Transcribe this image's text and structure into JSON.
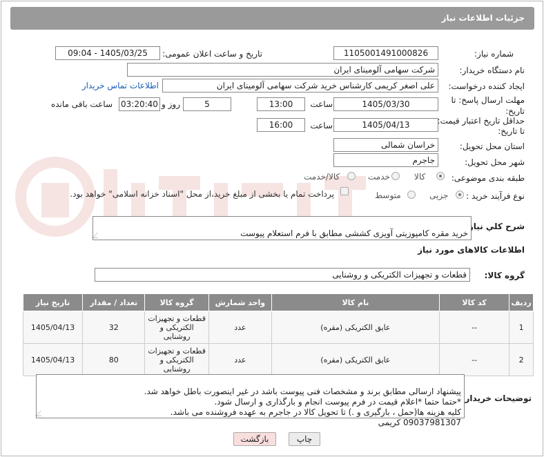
{
  "header": {
    "title": "جزئیات اطلاعات نیاز"
  },
  "form": {
    "need_number_label": "شماره نیاز:",
    "need_number": "1105001491000826",
    "announce_label": "تاریخ و ساعت اعلان عمومی:",
    "announce_value": "1405/03/25 - 09:04",
    "buyer_org_label": "نام دستگاه خریدار:",
    "buyer_org": "شرکت سهامی آلومینای ایران",
    "creator_label": "ایجاد کننده درخواست:",
    "creator": "علی اصغر کریمی کارشناس خرید شرکت سهامی آلومینای ایران",
    "contact_link": "اطلاعات تماس خریدار",
    "deadline_label_1": "مهلت ارسال پاسخ: تا",
    "deadline_label_2": "تاریخ:",
    "deadline_date": "1405/03/30",
    "time_label": "ساعت",
    "deadline_time": "13:00",
    "days_value": "5",
    "days_label": "روز و",
    "remaining_value": "03:20:40",
    "remaining_label": "ساعت باقی مانده",
    "validity_label_1": "حداقل تاریخ اعتبار قیمت:",
    "validity_label_2": "تا تاریخ:",
    "validity_date": "1405/04/13",
    "validity_time": "16:00",
    "province_label": "استان محل تحویل:",
    "province": "خراسان شمالی",
    "city_label": "شهر محل تحویل:",
    "city": "جاجرم",
    "category_label": "طبقه بندی موضوعی:",
    "category_options": [
      "کالا",
      "خدمت",
      "کالا/خدمت"
    ],
    "purchase_type_label": "نوع فرآیند خرید :",
    "purchase_options": [
      "جزیی",
      "متوسط"
    ],
    "payment_note": "پرداخت تمام یا بخشی از مبلغ خرید،از محل \"اسناد خزانه اسلامی\" خواهد بود."
  },
  "description": {
    "label": "شرح کلي نياز:",
    "text": "خرید مقره کامپوزیتی آویزی کششی مطابق با فرم استعلام پیوست"
  },
  "goods": {
    "section_title": "اطلاعات کالاهای مورد نیاز",
    "group_label": "گروه کالا:",
    "group_value": "قطعات و تجهیزات الکتریکی و روشنایی",
    "columns": [
      "ردیف",
      "کد کالا",
      "نام کالا",
      "واحد شمارش",
      "گروه کالا",
      "تعداد / مقدار",
      "تاریخ نیاز"
    ],
    "rows": [
      {
        "row": "1",
        "code": "--",
        "name": "عایق الکتریکی (مقره)",
        "unit": "عدد",
        "group": "قطعات و تجهیزات الکتریکی و روشنایی",
        "qty": "32",
        "date": "1405/04/13"
      },
      {
        "row": "2",
        "code": "--",
        "name": "عایق الکتریکی (مقره)",
        "unit": "عدد",
        "group": "قطعات و تجهیزات الکتریکی و روشنایی",
        "qty": "80",
        "date": "1405/04/13"
      }
    ]
  },
  "buyer_notes": {
    "label": "توضیحات خریدار:",
    "text": "پیشنهاد ارسالی مطابق برند و مشخصات فنی پیوست باشد در غیر اینصورت باطل خواهد شد.\n*حتما حتما *اعلام قیمت در فرم پیوست انجام و بارگذاری و ارسال شود.\nکلیه هزینه ها(حمل ، بارگیری و .) تا تحویل کالا در جاجرم به عهده فروشنده می باشد.\n09037981307 کریمی"
  },
  "buttons": {
    "print": "چاپ",
    "back": "بازگشت"
  },
  "colors": {
    "title_bar": "#9a9a9a",
    "table_header": "#8b8b8b",
    "link": "#1a5db5",
    "back_button": "#f9dede"
  }
}
